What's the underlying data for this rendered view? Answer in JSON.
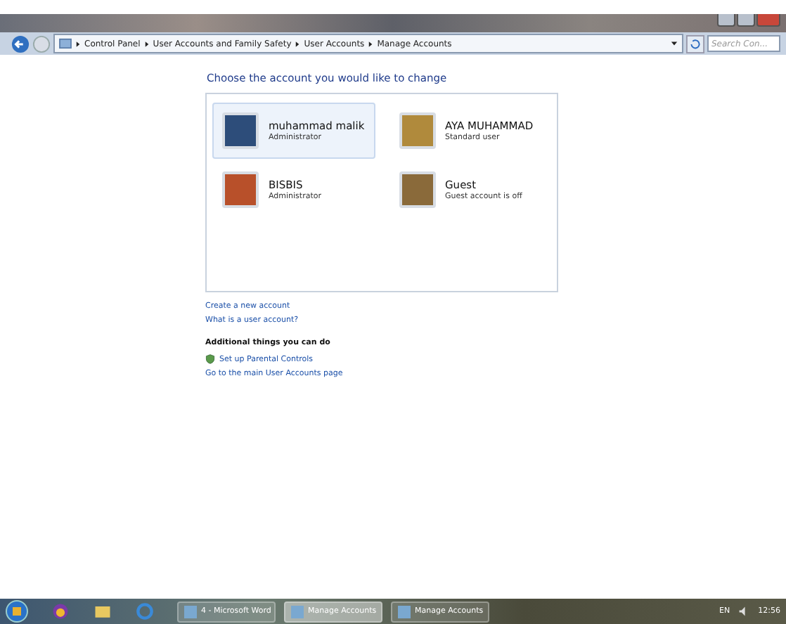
{
  "window": {
    "breadcrumb": [
      "Control Panel",
      "User Accounts and Family Safety",
      "User Accounts",
      "Manage Accounts"
    ],
    "search": {
      "placeholder": "Search Con..."
    }
  },
  "heading": "Choose the account you would like to change",
  "accounts": [
    {
      "name": "muhammad malik",
      "role": "Administrator",
      "selected": true
    },
    {
      "name": "AYA MUHAMMAD",
      "role": "Standard user",
      "selected": false
    },
    {
      "name": "BISBIS",
      "role": "Administrator",
      "selected": false
    },
    {
      "name": "Guest",
      "role": "Guest account is off",
      "selected": false
    }
  ],
  "links": [
    "Create a new account",
    "What is a user account?"
  ],
  "additional": {
    "title": "Additional things you can do",
    "links": [
      {
        "label": "Set up Parental Controls",
        "kind": "shield"
      },
      {
        "label": "Go to the main User Accounts page",
        "kind": "plain"
      }
    ]
  },
  "taskbar": {
    "tasks": [
      {
        "label": "4 - Microsoft Word",
        "selected": false
      },
      {
        "label": "Manage Accounts",
        "selected": true
      },
      {
        "label": "Manage Accounts",
        "selected": false
      }
    ],
    "language": "EN",
    "time": "12:56"
  }
}
